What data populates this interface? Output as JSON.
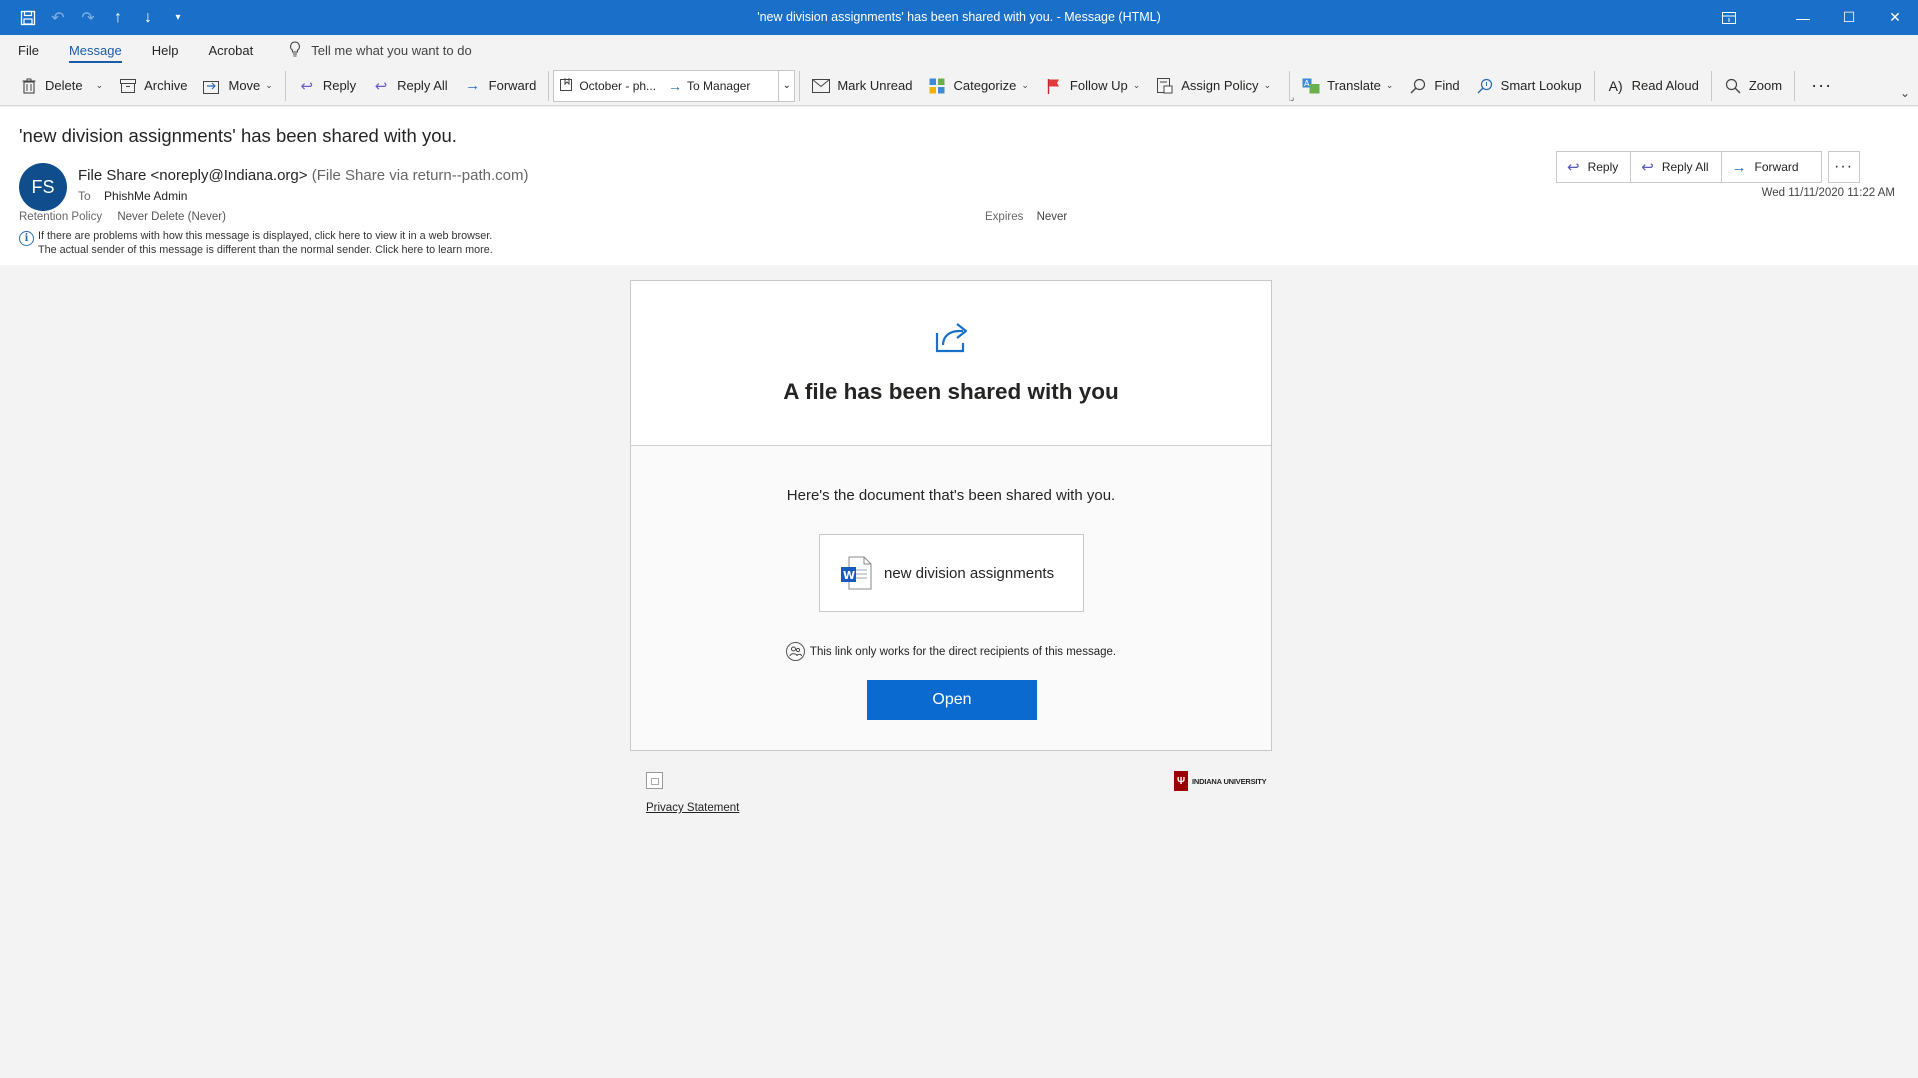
{
  "window": {
    "title": "'new division assignments' has been shared with you.  -  Message (HTML)"
  },
  "menu": {
    "tabs": [
      "File",
      "Message",
      "Help",
      "Acrobat"
    ],
    "tell_me": "Tell me what you want to do"
  },
  "ribbon": {
    "delete": "Delete",
    "archive": "Archive",
    "move": "Move",
    "reply": "Reply",
    "reply_all": "Reply All",
    "forward": "Forward",
    "quick_step_1": "October - ph...",
    "quick_step_2": "To Manager",
    "mark_unread": "Mark Unread",
    "categorize": "Categorize",
    "follow_up": "Follow Up",
    "assign_policy": "Assign Policy",
    "translate": "Translate",
    "find": "Find",
    "smart_lookup": "Smart Lookup",
    "read_aloud": "Read Aloud",
    "zoom": "Zoom"
  },
  "message": {
    "subject": "'new division assignments' has been shared with you.",
    "avatar_initials": "FS",
    "sender": "File Share <noreply@Indiana.org>",
    "sender_via": "(File Share via return--path.com)",
    "to_label": "To",
    "to": "PhishMe Admin",
    "retention_label": "Retention Policy",
    "retention_value": "Never Delete (Never)",
    "expires_label": "Expires",
    "expires_value": "Never",
    "info_line_1": "If there are problems with how this message is displayed, click here to view it in a web browser.",
    "info_line_2": "The actual sender of this message is different than the normal sender. Click here to learn more.",
    "date": "Wed 11/11/2020 11:22 AM",
    "reply": "Reply",
    "reply_all": "Reply All",
    "forward": "Forward"
  },
  "email": {
    "title": "A file has been shared with you",
    "subtitle": "Here's the document that's been shared with you.",
    "document_name": "new division assignments",
    "link_note": "This link only works for the direct recipients of this message.",
    "open_button": "Open",
    "privacy": "Privacy Statement",
    "logo_mark": "Ψ",
    "logo_text": "INDIANA UNIVERSITY"
  },
  "colors": {
    "titlebar": "#1a6fc9",
    "accent": "#0a6ad0",
    "avatar": "#0f4d8c",
    "iu_crimson": "#990000"
  }
}
